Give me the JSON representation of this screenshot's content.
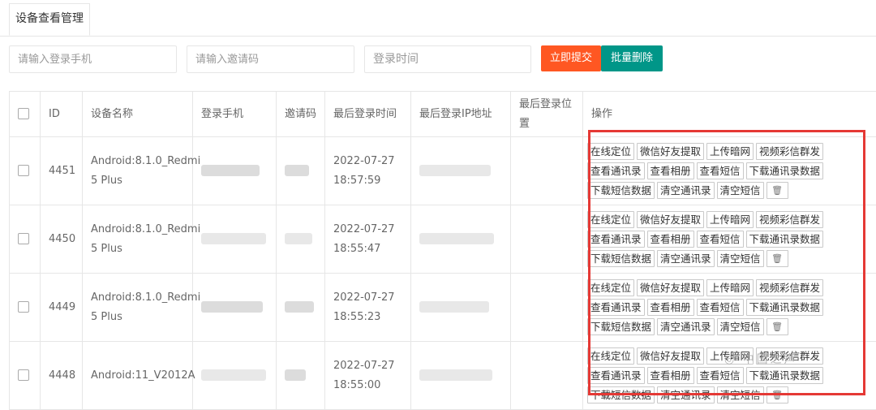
{
  "tab": {
    "label": "设备查看管理"
  },
  "filters": {
    "phone_placeholder": "请输入登录手机",
    "invite_placeholder": "请输入邀请码",
    "time_placeholder": "登录时间",
    "submit_label": "立即提交",
    "bulk_delete_label": "批量删除"
  },
  "table": {
    "headers": {
      "id": "ID",
      "device_name": "设备名称",
      "login_phone": "登录手机",
      "invite_code": "邀请码",
      "last_login_time": "最后登录时间",
      "last_login_ip": "最后登录IP地址",
      "last_login_location": "最后登录位置",
      "actions": "操作"
    },
    "rows": [
      {
        "id": "4451",
        "device": "Android:8.1.0_Redmi 5 Plus",
        "date": "2022-07-27",
        "time": "18:57:59"
      },
      {
        "id": "4450",
        "device": "Android:8.1.0_Redmi 5 Plus",
        "date": "2022-07-27",
        "time": "18:55:47"
      },
      {
        "id": "4449",
        "device": "Android:8.1.0_Redmi 5 Plus",
        "date": "2022-07-27",
        "time": "18:55:23"
      },
      {
        "id": "4448",
        "device": "Android:11_V2012A",
        "date": "2022-07-27",
        "time": "18:55:00"
      }
    ],
    "actions": {
      "online_locate": "在线定位",
      "wechat_friends": "微信好友提取",
      "upload_darknet": "上传暗网",
      "video_mms": "视频彩信群发",
      "view_contacts": "查看通讯录",
      "view_album": "查看相册",
      "view_sms": "查看短信",
      "download_contacts": "下载通讯录数据",
      "download_sms": "下载短信数据",
      "clear_contacts": "清空通讯录",
      "clear_sms": "清空短信",
      "delete_icon": "trash-icon"
    }
  },
  "watermark": "◎ 中国之声"
}
